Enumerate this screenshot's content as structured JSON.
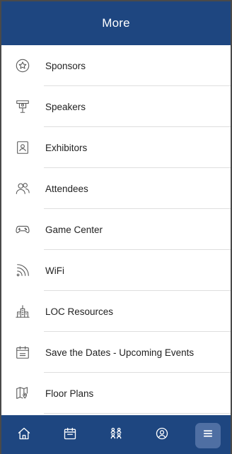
{
  "header": {
    "title": "More"
  },
  "menu": {
    "items": [
      {
        "label": "Sponsors",
        "icon": "star-badge-icon"
      },
      {
        "label": "Speakers",
        "icon": "podium-icon"
      },
      {
        "label": "Exhibitors",
        "icon": "id-badge-icon"
      },
      {
        "label": "Attendees",
        "icon": "people-icon"
      },
      {
        "label": "Game Center",
        "icon": "gamepad-icon"
      },
      {
        "label": "WiFi",
        "icon": "wifi-icon"
      },
      {
        "label": "LOC Resources",
        "icon": "buildings-icon"
      },
      {
        "label": "Save the Dates - Upcoming Events",
        "icon": "calendar-icon"
      },
      {
        "label": "Floor Plans",
        "icon": "map-pin-icon"
      }
    ]
  },
  "bottom_nav": {
    "items": [
      {
        "icon": "home-icon",
        "active": false
      },
      {
        "icon": "calendar-icon",
        "active": false
      },
      {
        "icon": "people-group-icon",
        "active": false
      },
      {
        "icon": "profile-icon",
        "active": false
      },
      {
        "icon": "menu-icon",
        "active": true
      }
    ]
  },
  "colors": {
    "brand": "#1e4680",
    "active_pill": "#4f6fa3",
    "divider": "#dedede"
  }
}
